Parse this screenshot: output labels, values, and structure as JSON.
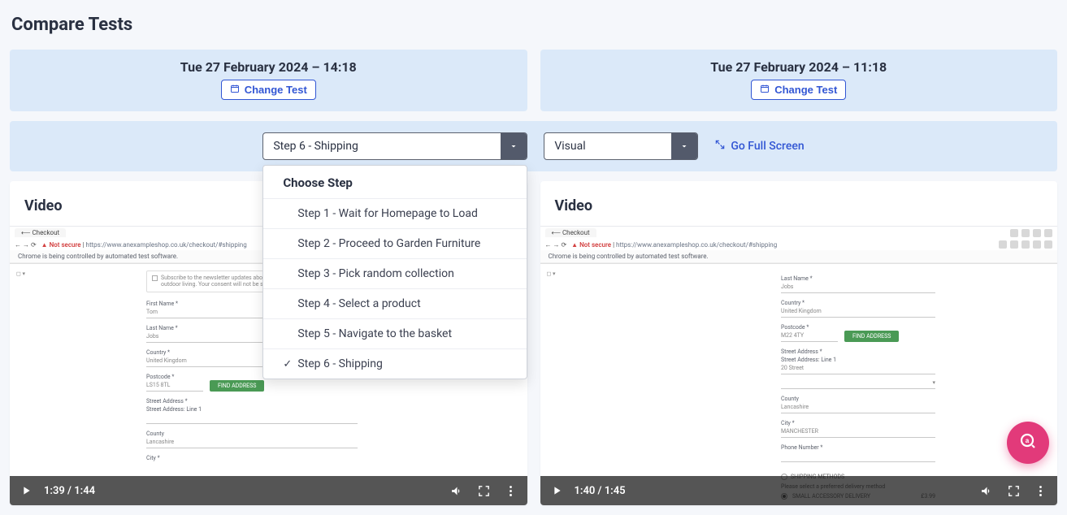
{
  "page_title": "Compare Tests",
  "tests": {
    "left": {
      "date": "Tue 27 February 2024 – 14:18",
      "change_label": "Change Test"
    },
    "right": {
      "date": "Tue 27 February 2024 – 11:18",
      "change_label": "Change Test"
    }
  },
  "controls": {
    "step_selected": "Step 6 - Shipping",
    "visual_selected": "Visual",
    "fullscreen_label": "Go Full Screen"
  },
  "dropdown": {
    "header": "Choose Step",
    "items": [
      {
        "label": "Step 1 - Wait for Homepage to Load",
        "selected": false
      },
      {
        "label": "Step 2 - Proceed to Garden Furniture",
        "selected": false
      },
      {
        "label": "Step 3 - Pick random collection",
        "selected": false
      },
      {
        "label": "Step 4 - Select a product",
        "selected": false
      },
      {
        "label": "Step 5 - Navigate to the basket",
        "selected": false
      },
      {
        "label": "Step 6 - Shipping",
        "selected": true
      }
    ]
  },
  "panels": {
    "left": {
      "title": "Video",
      "time": "1:39 / 1:44"
    },
    "right": {
      "title": "Video",
      "time": "1:40 / 1:45"
    }
  },
  "mock_page": {
    "tab": "Checkout",
    "not_secure": "Not secure",
    "url": "https://www.anexampleshop.co.uk/checkout/#shipping",
    "banner": "Chrome is being controlled by automated test software.",
    "subscribe": "Subscribe to the newsletter updates about the products and events for outdoor living. Your consent will not be shared.",
    "find_btn": "FIND ADDRESS",
    "labels": {
      "first_name": "First Name *",
      "last_name": "Last Name *",
      "country": "Country *",
      "postcode": "Postcode *",
      "street_address": "Street Address *",
      "street_address_l1": "Street Address: Line 1",
      "county": "County",
      "city": "City *",
      "phone": "Phone Number *",
      "shipping_methods": "SHIPPING METHODS",
      "ship_prompt": "Please select a preferred delivery method",
      "ship_option": "SMALL ACCESSORY DELIVERY"
    },
    "values": {
      "first_name": "Tom",
      "last_name": "Jobs",
      "country": "United Kingdom",
      "postcode_left": "LS15 8TL",
      "postcode_right": "M22 4TY",
      "county": "Lancashire",
      "street_l1": "20 Street",
      "city_right": "MANCHESTER",
      "ship_price": "£3.99"
    }
  }
}
